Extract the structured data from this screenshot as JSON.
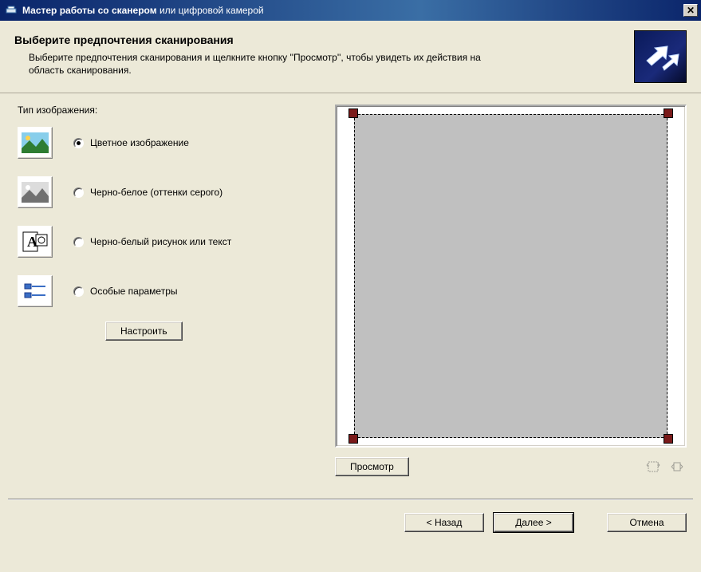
{
  "window": {
    "title_bold": "Мастер работы со сканером",
    "title_thin": " или цифровой камерой"
  },
  "header": {
    "title": "Выберите предпочтения сканирования",
    "description": "Выберите предпочтения сканирования и щелкните кнопку ''Просмотр'', чтобы увидеть их действия на область сканирования."
  },
  "left": {
    "section_label": "Тип изображения:",
    "options": [
      {
        "label": "Цветное изображение",
        "checked": true
      },
      {
        "label": "Черно-белое (оттенки серого)",
        "checked": false
      },
      {
        "label": "Черно-белый рисунок или текст",
        "checked": false
      },
      {
        "label": "Особые параметры",
        "checked": false
      }
    ],
    "configure_label": "Настроить"
  },
  "preview": {
    "button_label": "Просмотр"
  },
  "footer": {
    "back": "< Назад",
    "next": "Далее >",
    "cancel": "Отмена"
  }
}
